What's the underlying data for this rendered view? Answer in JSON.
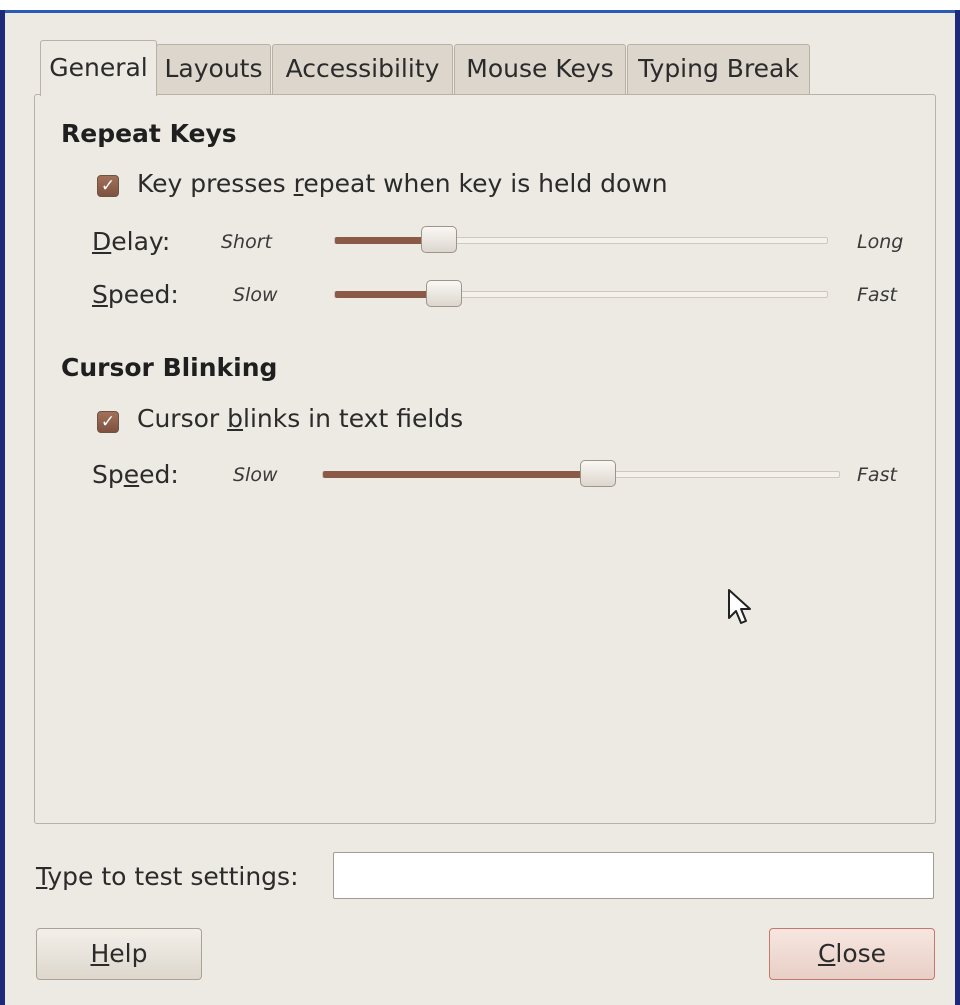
{
  "tabs": [
    {
      "label": "General",
      "active": true
    },
    {
      "label": "Layouts",
      "active": false
    },
    {
      "label": "Accessibility",
      "active": false
    },
    {
      "label": "Mouse Keys",
      "active": false
    },
    {
      "label": "Typing Break",
      "active": false
    }
  ],
  "repeat_keys": {
    "heading": "Repeat Keys",
    "checkbox": {
      "label_prefix": "Key presses ",
      "label_mnemonic": "r",
      "label_suffix": "epeat when key is held down",
      "checked": true
    },
    "delay": {
      "label_mnemonic": "D",
      "label_rest": "elay:",
      "min_label": "Short",
      "max_label": "Long",
      "value_fraction": 0.21
    },
    "speed": {
      "label_mnemonic": "S",
      "label_rest": "peed:",
      "min_label": "Slow",
      "max_label": "Fast",
      "value_fraction": 0.22
    }
  },
  "cursor_blinking": {
    "heading": "Cursor Blinking",
    "checkbox": {
      "label_prefix": "Cursor ",
      "label_mnemonic": "b",
      "label_suffix": "links in text fields",
      "checked": true
    },
    "speed": {
      "label_before": "Sp",
      "label_mnemonic": "e",
      "label_after": "ed:",
      "min_label": "Slow",
      "max_label": "Fast",
      "value_fraction": 0.53
    }
  },
  "test": {
    "label_mnemonic": "T",
    "label_rest": "ype to test settings:",
    "value": "",
    "placeholder": ""
  },
  "buttons": {
    "help": {
      "mnemonic": "H",
      "rest": "elp"
    },
    "close": {
      "mnemonic": "C",
      "rest": "lose"
    }
  },
  "colors": {
    "accent": "#8b5a46",
    "background": "#ede9e3",
    "frame": "#1d2a7a"
  },
  "icons": {
    "check": "checkmark-icon",
    "cursor": "mouse-pointer-icon"
  }
}
